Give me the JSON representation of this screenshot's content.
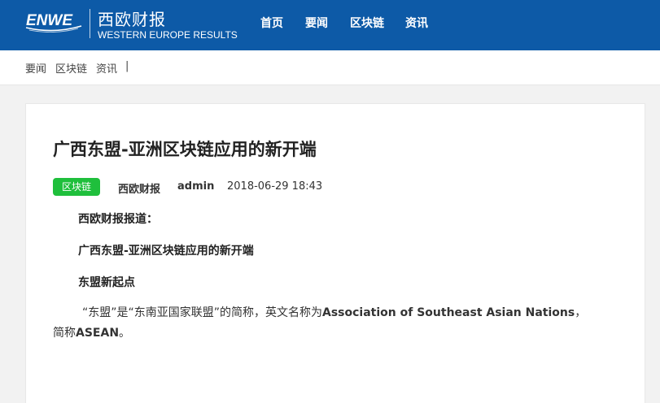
{
  "header": {
    "logo_text": "ENWE",
    "brand_cn": "西欧财报",
    "brand_en": "WESTERN EUROPE RESULTS",
    "nav": [
      "首页",
      "要闻",
      "区块链",
      "资讯"
    ]
  },
  "breadcrumb": {
    "items": [
      "要闻",
      "区块链",
      "资讯"
    ],
    "separator": "|"
  },
  "article": {
    "title": "广西东盟-亚洲区块链应用的新开端",
    "tag": "区块链",
    "source": "西欧财报",
    "author": "admin",
    "datetime": "2018-06-29 18:43",
    "lead": "西欧财报报道：",
    "subtitle": "广西东盟-亚洲区块链应用的新开端",
    "section_heading": "东盟新起点",
    "body_line1_prefix": "“东盟”是“东南亚国家联盟”的简称，英文名称为",
    "body_line1_bold": "Association of Southeast Asian Nations",
    "body_line1_suffix": "，",
    "body_line2_prefix": "简称",
    "body_line2_bold": "ASEAN",
    "body_line2_suffix": "。"
  },
  "colors": {
    "header_bg": "#0d5aa7",
    "tag_bg": "#1fbf3c"
  }
}
